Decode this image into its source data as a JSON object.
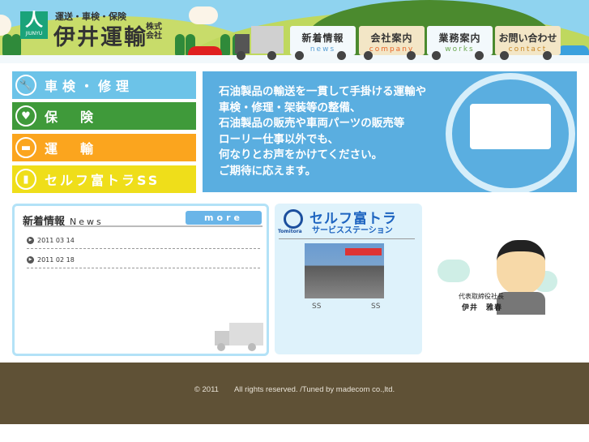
{
  "header": {
    "logo_text": "JIUNYU",
    "tagline": "運送・車検・保険",
    "company_name": "伊井運輸",
    "company_suffix": "株式会社"
  },
  "nav": [
    {
      "label": "新着情報",
      "sub": "news",
      "color": "#5a9fd4"
    },
    {
      "label": "会社案内",
      "sub": "company",
      "color": "#e8672a"
    },
    {
      "label": "業務案内",
      "sub": "works",
      "color": "#6aa84f"
    },
    {
      "label": "お問い合わせ",
      "sub": "contact",
      "color": "#c98a2a"
    }
  ],
  "menu": [
    {
      "label": "車検・修理",
      "icon": "wrench-icon",
      "color": "#6cc3e8"
    },
    {
      "label": "保　険",
      "icon": "heart-icon",
      "color": "#3f9a3a"
    },
    {
      "label": "運　輸",
      "icon": "truck-icon",
      "color": "#fba51e"
    },
    {
      "label": "セルフ富トラSS",
      "icon": "fuel-pump-icon",
      "color": "#efde1a"
    }
  ],
  "banner": {
    "lines": [
      "石油製品の輸送を一貫して手掛ける運輸や",
      "車検・修理・架装等の整備、",
      "石油製品の販売や車両パーツの販売等",
      "ローリー仕事以外でも、",
      "何なりとお声をかけてください。",
      "ご期待に応えます。"
    ]
  },
  "news": {
    "title": "新着情報",
    "title_en": "News",
    "more": "more",
    "items": [
      {
        "date": "2011 03 14"
      },
      {
        "date": "2011 02 18"
      }
    ]
  },
  "self": {
    "brand": "Tomitora",
    "title": "セルフ富トラ",
    "subtitle": "サービスステーション",
    "captions": [
      "SS",
      "SS"
    ]
  },
  "president": {
    "role": "代表取締役社長",
    "name": "伊井　雅春"
  },
  "footer": {
    "copyright": "© 2011　　All rights reserved. /Tuned by madecom co.,ltd."
  }
}
